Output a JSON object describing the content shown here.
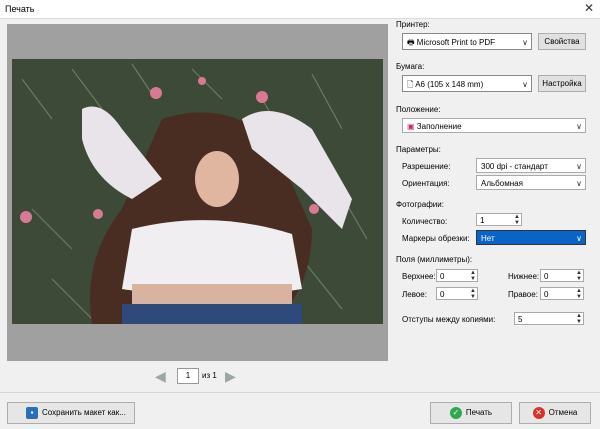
{
  "window": {
    "title": "Печать",
    "close_icon": "✕"
  },
  "preview": {
    "page_current": "1",
    "page_of": "из 1"
  },
  "printer": {
    "label": "Принтер:",
    "selected": "Microsoft Print to PDF",
    "properties_button": "Свойства"
  },
  "paper": {
    "label": "Бумага:",
    "selected": "A6 (105 x 148 mm)",
    "settings_button": "Настройка"
  },
  "position": {
    "label": "Положение:",
    "selected": "Заполнение"
  },
  "parameters": {
    "label": "Параметры:",
    "resolution_label": "Разрешение:",
    "resolution_value": "300 dpi - стандарт",
    "orientation_label": "Ориентация:",
    "orientation_value": "Альбомная"
  },
  "photos": {
    "label": "Фотографии:",
    "count_label": "Количество:",
    "count_value": "1",
    "crop_label": "Маркеры обрезки:",
    "crop_value": "Нет"
  },
  "margins": {
    "label": "Поля (миллиметры):",
    "top_label": "Верхнее:",
    "top_value": "0",
    "bottom_label": "Нижнее:",
    "bottom_value": "0",
    "left_label": "Левое:",
    "left_value": "0",
    "right_label": "Правое:",
    "right_value": "0",
    "spacing_label": "Отступы между копиями:",
    "spacing_value": "5"
  },
  "footer": {
    "save_layout": "Сохранить макет как...",
    "print": "Печать",
    "cancel": "Отмена"
  },
  "colors": {
    "print_icon": "#2fa84f",
    "cancel_icon": "#d9322b",
    "save_icon": "#2a6fb5",
    "selection": "#0a64c8"
  }
}
